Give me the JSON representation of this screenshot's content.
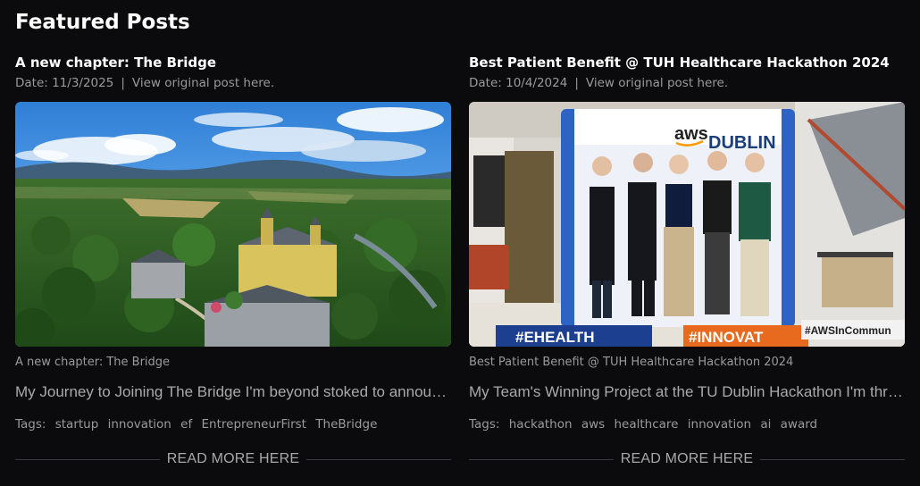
{
  "section": {
    "title": "Featured Posts"
  },
  "posts": [
    {
      "title": "A new chapter: The Bridge",
      "date": "Date: 11/3/2025",
      "separator": "|",
      "view_link": "View original post here.",
      "caption": "A new chapter: The Bridge",
      "excerpt": "My Journey to Joining The Bridge I'm beyond stoked to announce that I've joined The Bridge",
      "tags_label": "Tags:",
      "tags": [
        "startup",
        "innovation",
        "ef",
        "EntrepreneurFirst",
        "TheBridge"
      ],
      "read_more": "READ MORE HERE"
    },
    {
      "title": "Best Patient Benefit @ TUH Healthcare Hackathon 2024",
      "date": "Date: 10/4/2024",
      "separator": "|",
      "view_link": "View original post here.",
      "caption": "Best Patient Benefit @ TUH Healthcare Hackathon 2024",
      "excerpt": "My Team's Winning Project at the TU Dublin Hackathon I'm thrilled to share",
      "tags_label": "Tags:",
      "tags": [
        "hackathon",
        "aws",
        "healthcare",
        "innovation",
        "ai",
        "award"
      ],
      "read_more": "READ MORE HERE",
      "image_text": {
        "aws": "aws",
        "dublin": "DUBLIN",
        "ehealth": "#EHEALTH",
        "innovate": "#INNOVAT",
        "awsincommunity": "#AWSInCommun"
      }
    }
  ],
  "colors": {
    "background": "#0b0b0d",
    "title": "#ffffff",
    "muted": "#9a9a9a",
    "divider": "#3a3a3e"
  }
}
